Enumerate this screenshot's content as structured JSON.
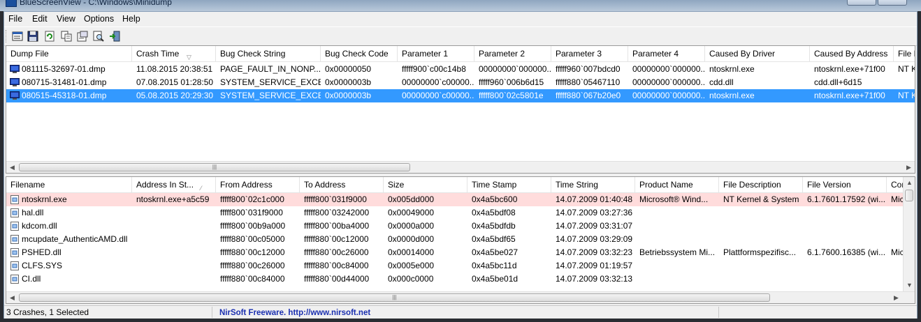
{
  "window": {
    "title": "BlueScreenView  -  C:\\Windows\\Minidump"
  },
  "menu": [
    "File",
    "Edit",
    "View",
    "Options",
    "Help"
  ],
  "toolbar": {
    "buttons": [
      {
        "name": "properties-window-icon"
      },
      {
        "name": "save-icon"
      },
      {
        "name": "refresh-icon"
      },
      {
        "name": "copy-icon"
      },
      {
        "name": "html-report-icon"
      },
      {
        "name": "find-icon"
      },
      {
        "name": "exit-icon"
      }
    ]
  },
  "top_table": {
    "columns": [
      "Dump File",
      "Crash Time",
      "Bug Check String",
      "Bug Check Code",
      "Parameter 1",
      "Parameter 2",
      "Parameter 3",
      "Parameter 4",
      "Caused By Driver",
      "Caused By Address",
      "File D"
    ],
    "rows": [
      {
        "state": "normal",
        "cells": [
          "081115-32697-01.dmp",
          "11.08.2015 20:38:51",
          "PAGE_FAULT_IN_NONP...",
          "0x00000050",
          "fffff900`c00c14b8",
          "00000000`000000...",
          "fffff960`007bdcd0",
          "00000000`000000...",
          "ntoskrnl.exe",
          "ntoskrnl.exe+71f00",
          "NT Ke"
        ]
      },
      {
        "state": "normal",
        "cells": [
          "080715-31481-01.dmp",
          "07.08.2015 01:28:50",
          "SYSTEM_SERVICE_EXCE...",
          "0x0000003b",
          "00000000`c00000...",
          "fffff960`006b6d15",
          "fffff880`05467110",
          "00000000`000000...",
          "cdd.dll",
          "cdd.dll+6d15",
          ""
        ]
      },
      {
        "state": "selected",
        "cells": [
          "080515-45318-01.dmp",
          "05.08.2015 20:29:30",
          "SYSTEM_SERVICE_EXCE...",
          "0x0000003b",
          "00000000`c00000...",
          "fffff800`02c5801e",
          "fffff880`067b20e0",
          "00000000`000000...",
          "ntoskrnl.exe",
          "ntoskrnl.exe+71f00",
          "NT Ke"
        ]
      }
    ]
  },
  "bottom_table": {
    "columns": [
      "Filename",
      "Address In St...",
      "From Address",
      "To Address",
      "Size",
      "Time Stamp",
      "Time String",
      "Product Name",
      "File Description",
      "File Version",
      "Con"
    ],
    "rows": [
      {
        "state": "highlight",
        "cells": [
          "ntoskrnl.exe",
          "ntoskrnl.exe+a5c59",
          "fffff800`02c1c000",
          "fffff800`031f9000",
          "0x005dd000",
          "0x4a5bc600",
          "14.07.2009 01:40:48",
          "Microsoft® Wind...",
          "NT Kernel & System",
          "6.1.7601.17592 (wi...",
          "Mic"
        ]
      },
      {
        "state": "normal",
        "cells": [
          "hal.dll",
          "",
          "fffff800`031f9000",
          "fffff800`03242000",
          "0x00049000",
          "0x4a5bdf08",
          "14.07.2009 03:27:36",
          "",
          "",
          "",
          ""
        ]
      },
      {
        "state": "normal",
        "cells": [
          "kdcom.dll",
          "",
          "fffff800`00b9a000",
          "fffff800`00ba4000",
          "0x0000a000",
          "0x4a5bdfdb",
          "14.07.2009 03:31:07",
          "",
          "",
          "",
          ""
        ]
      },
      {
        "state": "normal",
        "cells": [
          "mcupdate_AuthenticAMD.dll",
          "",
          "fffff880`00c05000",
          "fffff880`00c12000",
          "0x0000d000",
          "0x4a5bdf65",
          "14.07.2009 03:29:09",
          "",
          "",
          "",
          ""
        ]
      },
      {
        "state": "normal",
        "cells": [
          "PSHED.dll",
          "",
          "fffff880`00c12000",
          "fffff880`00c26000",
          "0x00014000",
          "0x4a5be027",
          "14.07.2009 03:32:23",
          "Betriebssystem Mi...",
          "Plattformspezifisc...",
          "6.1.7600.16385 (wi...",
          "Mic"
        ]
      },
      {
        "state": "normal",
        "cells": [
          "CLFS.SYS",
          "",
          "fffff880`00c26000",
          "fffff880`00c84000",
          "0x0005e000",
          "0x4a5bc11d",
          "14.07.2009 01:19:57",
          "",
          "",
          "",
          ""
        ]
      },
      {
        "state": "normal",
        "cells": [
          "CI.dll",
          "",
          "fffff880`00c84000",
          "fffff880`00d44000",
          "0x000c0000",
          "0x4a5be01d",
          "14.07.2009 03:32:13",
          "",
          "",
          "",
          ""
        ]
      }
    ]
  },
  "status": {
    "crashes": "3 Crashes, 1 Selected",
    "link": "NirSoft Freeware.  http://www.nirsoft.net"
  },
  "colors": {
    "selection": "#3399ff",
    "highlight_row": "#ffdcdc",
    "link": "#1a2fb0"
  }
}
